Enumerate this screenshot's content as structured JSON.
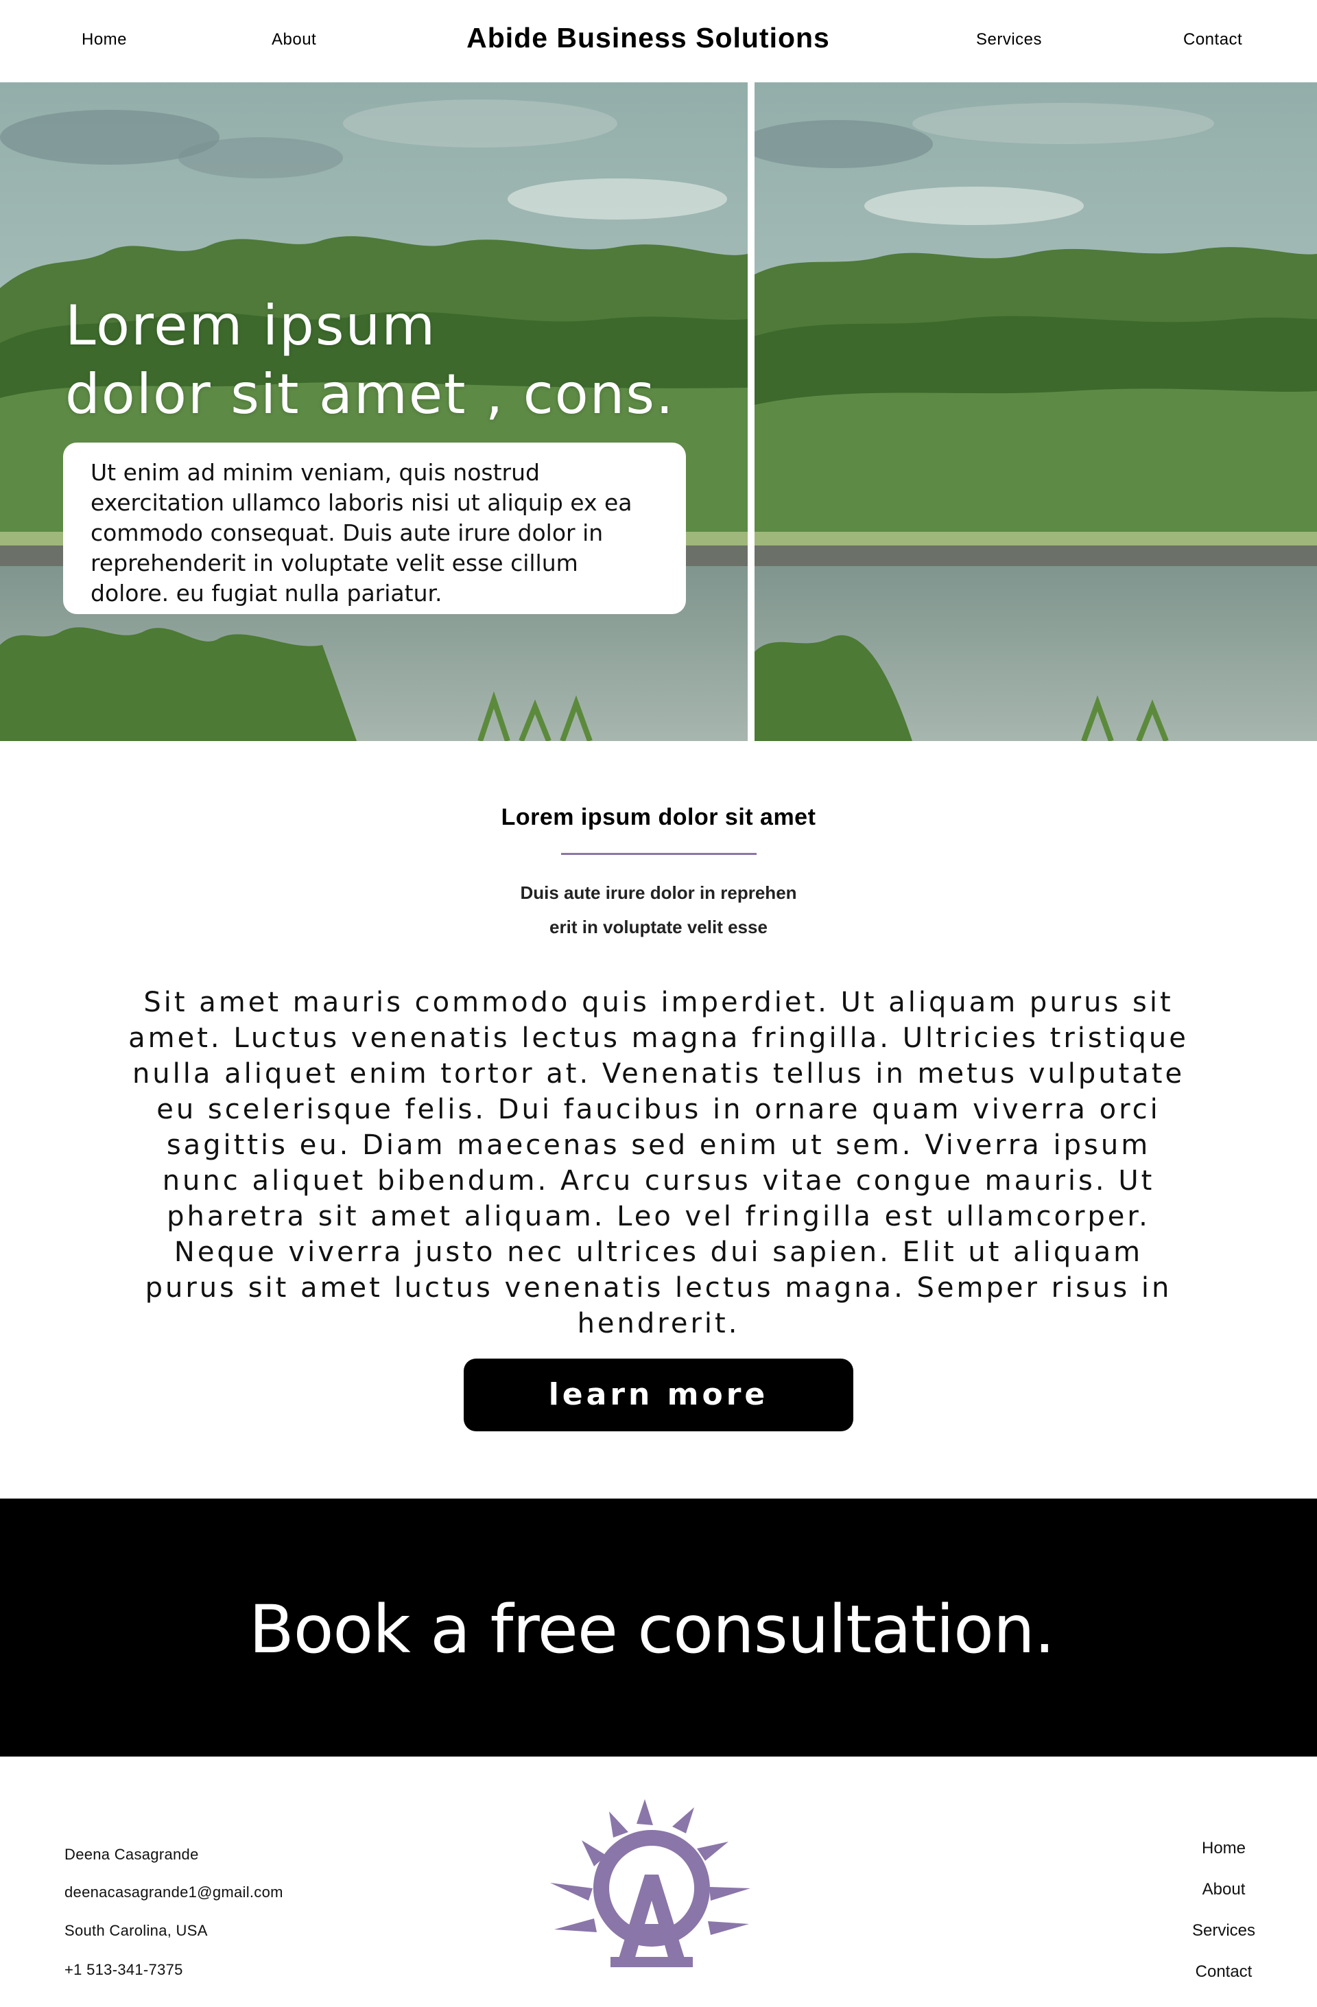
{
  "header": {
    "brand": "Abide Business Solutions",
    "nav": {
      "home": "Home",
      "about": "About",
      "services": "Services",
      "contact": "Contact"
    }
  },
  "hero": {
    "title_line1": "Lorem ipsum",
    "title_line2": "dolor sit amet , cons.",
    "card_text": "Ut enim ad minim veniam, quis nostrud exercitation ullamco laboris nisi ut aliquip ex ea commodo consequat. Duis aute irure dolor in reprehenderit in voluptate velit esse cillum dolore. eu fugiat nulla pariatur."
  },
  "intro": {
    "title": "Lorem ipsum dolor sit amet",
    "subtitle_line1": "Duis aute irure dolor in reprehen",
    "subtitle_line2": "erit in voluptate velit esse",
    "body": "Sit amet mauris commodo quis imperdiet. Ut aliquam purus sit amet. Luctus venenatis lectus magna fringilla. Ultricies tristique nulla aliquet enim tortor at. Venenatis tellus in metus vulputate eu scelerisque felis. Dui faucibus in ornare quam viverra orci sagittis eu. Diam maecenas sed enim ut sem. Viverra ipsum nunc aliquet bibendum. Arcu cursus vitae congue mauris. Ut pharetra sit amet aliquam. Leo vel fringilla est ullamcorper. Neque viverra justo nec ultrices dui sapien. Elit ut aliquam purus sit amet luctus venenatis lectus magna. Semper risus in hendrerit.",
    "button_label": "learn more"
  },
  "cta": {
    "text": "Book a free consultation."
  },
  "footer": {
    "name": "Deena Casagrande",
    "email": "deenacasagrande1@gmail.com",
    "location": "South Carolina, USA",
    "phone": "+1 513-341-7375",
    "nav": {
      "home": "Home",
      "about": "About",
      "services": "Services",
      "contact": "Contact"
    },
    "logo_icon": "sun-letter-a-logo"
  },
  "colors": {
    "accent": "#8a76a8",
    "band": "#000000"
  }
}
